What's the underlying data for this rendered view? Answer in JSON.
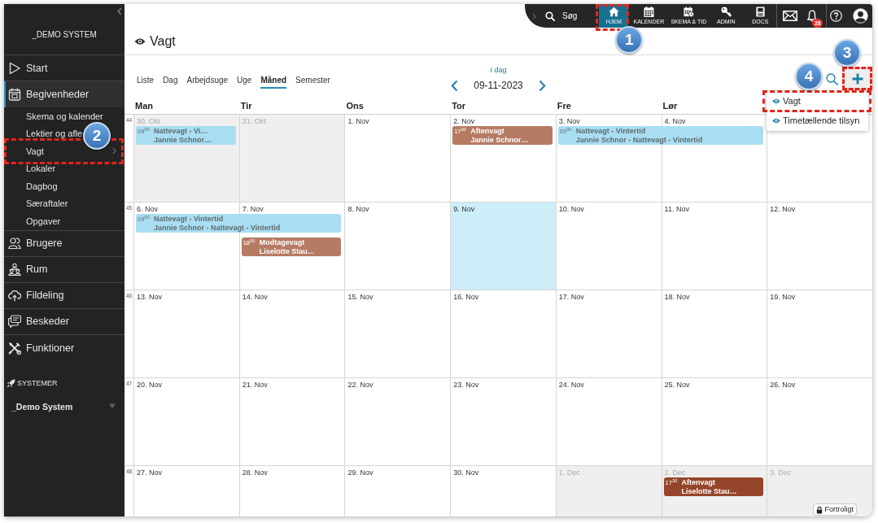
{
  "sidebar": {
    "system_name": "_DEMO SYSTEM",
    "items": [
      {
        "label": "Start",
        "selected": false
      },
      {
        "label": "Begivenheder",
        "selected": true,
        "children": [
          {
            "label": "Skema og kalender",
            "kind": "link",
            "highlighted": false
          },
          {
            "label": "Lektier og afle",
            "kind": "link",
            "highlighted": false
          },
          {
            "label": "Vagt",
            "kind": "submenu",
            "highlighted": true,
            "callout": "2"
          },
          {
            "label": "Lokaler",
            "kind": "link",
            "highlighted": false
          },
          {
            "label": "Dagbog",
            "kind": "link",
            "highlighted": false
          },
          {
            "label": "Særaftaler",
            "kind": "link",
            "highlighted": false
          },
          {
            "label": "Opgaver",
            "kind": "link",
            "highlighted": false
          }
        ]
      },
      {
        "label": "Brugere",
        "selected": false
      },
      {
        "label": "Rum",
        "selected": false
      },
      {
        "label": "Fildeling",
        "selected": false
      },
      {
        "label": "Beskeder",
        "selected": false
      },
      {
        "label": "Funktioner",
        "selected": false
      }
    ],
    "systems": {
      "heading": "SYSTEMER",
      "current": "_Demo System"
    }
  },
  "top_bar": {
    "search_label": "Søg",
    "nav": [
      {
        "label": "HJEM",
        "selected": true,
        "highlighted": true,
        "callout": "1"
      },
      {
        "label": "KALENDER",
        "selected": false,
        "highlighted": false
      },
      {
        "label": "SKEMA & TID",
        "selected": false,
        "highlighted": false
      },
      {
        "label": "ADMIN",
        "selected": false,
        "highlighted": false
      },
      {
        "label": "DOCS",
        "selected": false,
        "highlighted": false
      }
    ],
    "notification_count": "28"
  },
  "page": {
    "title": "Vagt"
  },
  "toolbar": {
    "views": [
      {
        "label": "Liste",
        "selected": false
      },
      {
        "label": "Dag",
        "selected": false
      },
      {
        "label": "Arbejdsuge",
        "selected": false
      },
      {
        "label": "Uge",
        "selected": false
      },
      {
        "label": "Måned",
        "selected": true
      },
      {
        "label": "Semester",
        "selected": false
      }
    ],
    "today_label": "I dag",
    "date": "09-11-2023",
    "add_button": {
      "open": true,
      "highlighted": true,
      "callout": "3"
    },
    "add_menu": [
      {
        "label": "Vagt",
        "highlighted": true,
        "callout": "4"
      },
      {
        "label": "Timetællende tilsyn",
        "highlighted": false
      }
    ]
  },
  "calendar": {
    "columns": [
      "Man",
      "Tir",
      "Ons",
      "Tor",
      "Fre",
      "Lør"
    ],
    "weeks": [
      {
        "number": "44",
        "days": [
          {
            "date": "30. Okt",
            "other_month": true,
            "today": false,
            "events": [
              {
                "time": "09$^{00}$",
                "title": "Nattevagt - Vi…",
                "person": "Jannie Schnor…",
                "color": "#a9def2",
                "continues": false
              }
            ]
          },
          {
            "date": "31. Okt",
            "other_month": true,
            "today": false
          },
          {
            "date": "1. Nov",
            "other_month": false,
            "today": false
          },
          {
            "date": "2. Nov",
            "other_month": false,
            "today": false,
            "events": [
              {
                "time": "17$^{30}$",
                "title": "Aftenvagt",
                "person": "Jannie Schnor…",
                "color": "#b67b63",
                "continues": false
              }
            ]
          },
          {
            "date": "3. Nov",
            "other_month": false,
            "today": false,
            "events": [
              {
                "time": "09$^{00}$",
                "title": "Nattevagt - Vintertid",
                "person": "Jannie Schnor - Nattevagt - Vintertid",
                "color": "#a9def2",
                "continues": true
              }
            ]
          },
          {
            "date": "4. Nov",
            "other_month": false,
            "today": false
          }
        ]
      },
      {
        "number": "45",
        "days": [
          {
            "date": "6. Nov",
            "other_month": false,
            "today": false,
            "events": [
              {
                "time": "09$^{00}$",
                "title": "Nattevagt - Vintertid",
                "person": "Jannie Schnor - Nattevagt - Vintertid",
                "color": "#a9def2",
                "continues": true
              }
            ]
          },
          {
            "date": "7. Nov",
            "other_month": false,
            "today": false,
            "events": [
              {
                "time": "18$^{00}$",
                "title": "Modtagevagt",
                "person": "Liselotte Stau…",
                "color": "#b67b63",
                "continues": false
              }
            ]
          },
          {
            "date": "8. Nov",
            "other_month": false,
            "today": false
          },
          {
            "date": "9. Nov",
            "other_month": false,
            "today": true
          },
          {
            "date": "10. Nov",
            "other_month": false,
            "today": false
          },
          {
            "date": "11. Nov",
            "other_month": false,
            "today": false
          },
          {
            "date": "12. Nov",
            "other_month": false,
            "today": false
          }
        ]
      },
      {
        "number": "46",
        "days": [
          {
            "date": "13. Nov",
            "other_month": false,
            "today": false
          },
          {
            "date": "14. Nov",
            "other_month": false,
            "today": false
          },
          {
            "date": "15. Nov",
            "other_month": false,
            "today": false
          },
          {
            "date": "16. Nov",
            "other_month": false,
            "today": false
          },
          {
            "date": "17. Nov",
            "other_month": false,
            "today": false
          },
          {
            "date": "18. Nov",
            "other_month": false,
            "today": false
          },
          {
            "date": "19. Nov",
            "other_month": false,
            "today": false
          }
        ]
      },
      {
        "number": "47",
        "days": [
          {
            "date": "20. Nov",
            "other_month": false,
            "today": false
          },
          {
            "date": "21. Nov",
            "other_month": false,
            "today": false
          },
          {
            "date": "22. Nov",
            "other_month": false,
            "today": false
          },
          {
            "date": "23. Nov",
            "other_month": false,
            "today": false
          },
          {
            "date": "24. Nov",
            "other_month": false,
            "today": false
          },
          {
            "date": "25. Nov",
            "other_month": false,
            "today": false
          },
          {
            "date": "26. Nov",
            "other_month": false,
            "today": false
          }
        ]
      },
      {
        "number": "48",
        "days": [
          {
            "date": "27. Nov",
            "other_month": false,
            "today": false
          },
          {
            "date": "28. Nov",
            "other_month": false,
            "today": false
          },
          {
            "date": "29. Nov",
            "other_month": false,
            "today": false
          },
          {
            "date": "30. Nov",
            "other_month": false,
            "today": false
          },
          {
            "date": "1. Dec",
            "other_month": true,
            "today": false
          },
          {
            "date": "2. Dec",
            "other_month": true,
            "today": false,
            "events": [
              {
                "time": "17$^{30}$",
                "title": "Aftenvagt",
                "person": "Liselotte Stau…",
                "color": "#95462a",
                "continues": false
              }
            ]
          },
          {
            "date": "3. Dec",
            "other_month": true,
            "today": false
          }
        ]
      }
    ]
  },
  "confidential_label": "Fortroligt"
}
